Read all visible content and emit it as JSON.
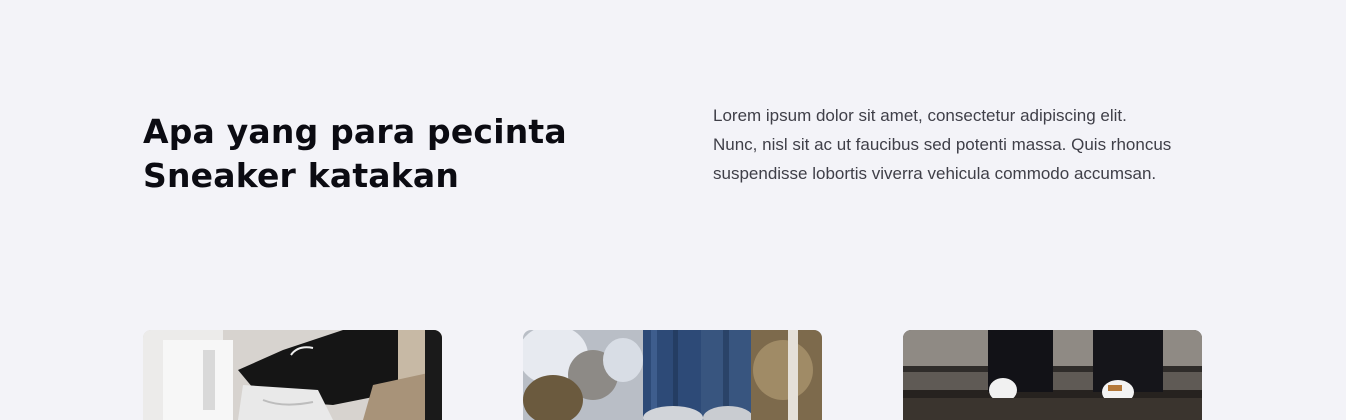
{
  "testimonials": {
    "heading_line1": "Apa yang para pecinta",
    "heading_line2": "Sneaker katakan",
    "intro_line1": "Lorem ipsum dolor sit amet, consectetur adipiscing elit.",
    "intro_line2": "Nunc, nisl sit ac ut faucibus sed potenti massa. Quis rhoncus",
    "intro_line3": "suspendisse lobortis viverra vehicula commodo accumsan."
  },
  "colors": {
    "background": "#f3f3f8",
    "heading": "#0b0b12",
    "body_text": "#3f3f48"
  },
  "cards": [
    {
      "image": "sneaker-photo-white-shoe"
    },
    {
      "image": "sneaker-photo-jeans"
    },
    {
      "image": "sneaker-photo-stairs"
    }
  ]
}
